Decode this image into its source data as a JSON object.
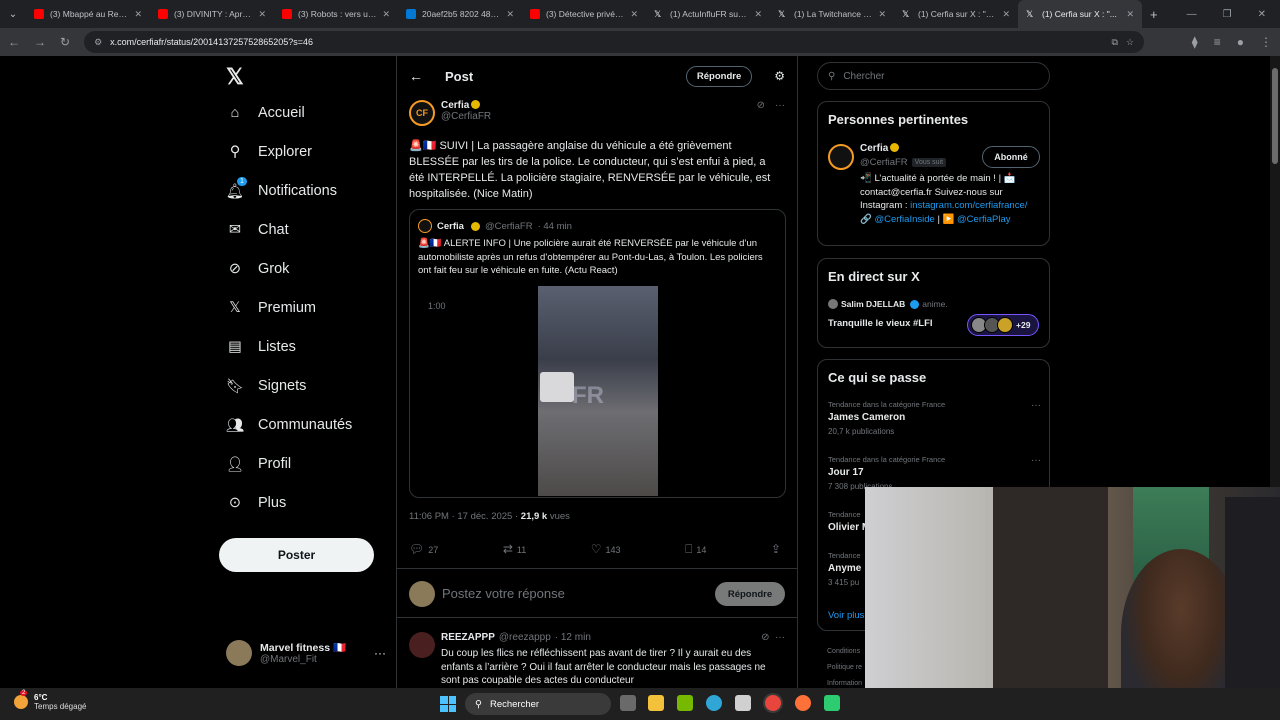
{
  "browser": {
    "tabs": [
      {
        "title": "(3) Mbappé au Real...",
        "color": "#ff0000"
      },
      {
        "title": "(3) DIVINITY : Après l...",
        "color": "#ff0000"
      },
      {
        "title": "(3) Robots : vers un n...",
        "color": "#ff0000"
      },
      {
        "title": "20aef2b5 8202 4818 ...",
        "color": "#0078d4"
      },
      {
        "title": "(3) Détective privée à...",
        "color": "#ff0000"
      },
      {
        "title": "(1) ActuInfluFR sur X",
        "color": "#ffffff"
      },
      {
        "title": "(1) La Twitchance (@...",
        "color": "#ffffff"
      },
      {
        "title": "(1) Cerfia sur X : \"🚨...",
        "color": "#ffffff"
      },
      {
        "title": "(1) Cerfia sur X : \"...",
        "color": "#ffffff"
      }
    ],
    "url": "x.com/cerfiafr/status/2001413725752865205?s=46"
  },
  "nav": {
    "items": [
      {
        "label": "Accueil",
        "icon": "home-icon"
      },
      {
        "label": "Explorer",
        "icon": "search-icon"
      },
      {
        "label": "Notifications",
        "icon": "bell-icon",
        "badge": "1"
      },
      {
        "label": "Chat",
        "icon": "mail-icon"
      },
      {
        "label": "Grok",
        "icon": "grok-icon"
      },
      {
        "label": "Premium",
        "icon": "x-icon"
      },
      {
        "label": "Listes",
        "icon": "list-icon"
      },
      {
        "label": "Signets",
        "icon": "bookmark-icon"
      },
      {
        "label": "Communautés",
        "icon": "communities-icon"
      },
      {
        "label": "Profil",
        "icon": "user-icon"
      },
      {
        "label": "Plus",
        "icon": "more-circle-icon"
      }
    ],
    "post_button": "Poster",
    "account": {
      "name": "Marvel fitness 🇫🇷",
      "handle": "@Marvel_Fit"
    }
  },
  "main": {
    "header_title": "Post",
    "reply_button": "Répondre",
    "tweet": {
      "author": "Cerfia",
      "handle": "@CerfiaFR",
      "text": "🚨🇫🇷 SUIVI | La passagère anglaise du véhicule a été grièvement BLESSÉE par les tirs de la police. Le conducteur, qui s’est enfui à pied, a été INTERPELLÉ. La policière stagiaire, RENVERSÉE par le véhicule, est hospitalisée. (Nice Matin)",
      "quote": {
        "author": "Cerfia",
        "handle": "@CerfiaFR",
        "time": "· 44 min",
        "text": "🚨🇫🇷 ALERTE INFO | Une policière aurait été RENVERSÉE par le véhicule d’un automobiliste après un refus d’obtempérer au Pont-du-Las, à Toulon. Les policiers ont fait feu sur le véhicule en fuite. (Actu React)",
        "video_time": "1:00"
      },
      "timestamp": "11:06 PM · 17 déc. 2025 · ",
      "views_count": "21,9 k",
      "views_label": " vues",
      "stats": {
        "replies": "27",
        "reposts": "11",
        "likes": "143",
        "bookmarks": "14"
      }
    },
    "compose": {
      "placeholder": "Postez votre réponse",
      "button": "Répondre"
    },
    "reply": {
      "author": "REEZAPPP",
      "handle": "@reezappp",
      "time": "· 12 min",
      "text": "Du coup les flics ne réfléchissent pas avant de tirer ? Il y aurait eu des enfants a l’arrière ? Oui il faut arrêter le conducteur mais les passages ne sont pas coupable des actes du conducteur"
    }
  },
  "right": {
    "search_placeholder": "Chercher",
    "relevant": {
      "title": "Personnes pertinentes",
      "name": "Cerfia",
      "handle": "@CerfiaFR",
      "follows_you": "Vous suit",
      "follow_button": "Abonné",
      "bio_prefix": "📲 L’actualité à portée de main ! | 📩 contact@cerfia.fr Suivez-nous sur Instagram : ",
      "bio_link1": "instagram.com/cerfiafrance/",
      "bio_mid": " 🔗 ",
      "bio_link2": "@CerfiaInside",
      "bio_sep": " | ▶️ ",
      "bio_link3": "@CerfiaPlay"
    },
    "live": {
      "title": "En direct sur X",
      "host": "Salim DJELLAB",
      "role": "anime.",
      "space_title": "Tranquille le vieux #LFI",
      "listeners": "+29"
    },
    "trends": {
      "title": "Ce qui se passe",
      "items": [
        {
          "category": "Tendance dans la catégorie France",
          "name": "James Cameron",
          "count": "20,7 k publications"
        },
        {
          "category": "Tendance dans la catégorie France",
          "name": "Jour 17",
          "count": "7 308 publications"
        },
        {
          "category": "Tendance",
          "name": "Olivier M",
          "count": ""
        },
        {
          "category": "Tendance",
          "name": "Anyme",
          "count": "3 415 pu"
        }
      ],
      "show_more": "Voir plus"
    },
    "footer": {
      "line1": "Conditions",
      "line2": "Politique re",
      "line3": "Information"
    }
  },
  "taskbar": {
    "temp": "6°C",
    "condition": "Temps dégagé",
    "search": "Rechercher",
    "weather_badge": "2"
  }
}
